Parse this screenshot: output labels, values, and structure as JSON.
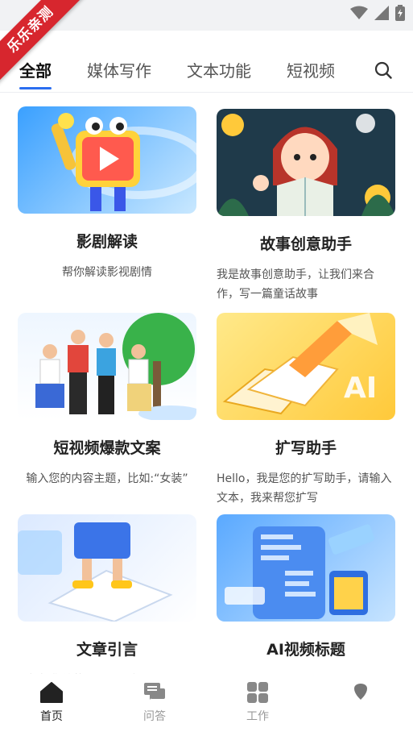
{
  "ribbon": {
    "text": "乐乐亲测"
  },
  "tabs": [
    {
      "label": "全部"
    },
    {
      "label": "媒体写作"
    },
    {
      "label": "文本功能"
    },
    {
      "label": "短视频"
    }
  ],
  "cards": [
    {
      "title": "影剧解读",
      "desc": "帮你解读影视剧情"
    },
    {
      "title": "故事创意助手",
      "desc": "我是故事创意助手，让我们来合作，写一篇童话故事"
    },
    {
      "title": "短视频爆款文案",
      "desc": "输入您的内容主题，比如:“女装”"
    },
    {
      "title": "扩写助手",
      "desc": "Hello，我是您的扩写助手，请输入文本，我来帮您扩写"
    },
    {
      "title": "文章引言",
      "desc": "根据您给的主题写一段引人入胜"
    },
    {
      "title": "AI视频标题",
      "desc": ""
    }
  ],
  "thumb_badge": "AI",
  "bottom_nav": [
    {
      "label": "首页"
    },
    {
      "label": "问答"
    },
    {
      "label": "工作"
    },
    {
      "label": ""
    }
  ]
}
